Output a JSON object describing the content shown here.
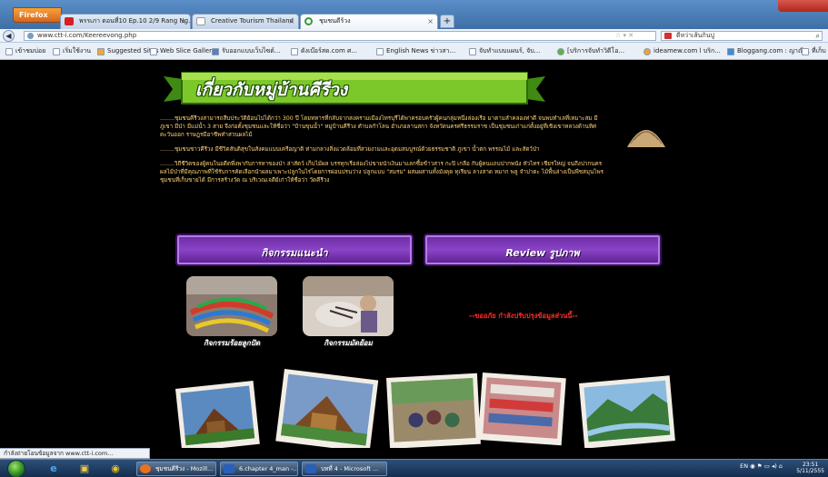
{
  "browser": {
    "app_button": "Firefox",
    "tabs": [
      {
        "label": "พรรเภา ตอนที่10 Ep.10 2/9 Rang Ng...",
        "favicon_color": "#d62020"
      },
      {
        "label": "Creative Tourism Thailand",
        "favicon_color": "#ffffff"
      },
      {
        "label": "ชุมชนดีร้วง",
        "favicon_color": "#3a9a3a"
      }
    ],
    "new_tab": "+",
    "url": "www.ctt-i.com/Keereevong.php",
    "search_text": "ดีหว่าเส้นกินปู",
    "bookmarks": [
      "เข้าชมบ่อย",
      "เริ่มใช้งาน",
      "Suggested Sites",
      "Web Slice Gallery",
      "รับออกแบบเว็บไซต์...",
      "ดังเบ๊อร์สด.com ศ...",
      "English News ข่าวสา...",
      "จับทำแบบแผนร์, จับ...",
      "[บริการจับทำวิดีโอ...",
      "ideamew.com l บริก...",
      "Bloggang.com : ญาณี...",
      "ที่เก็บ"
    ]
  },
  "page": {
    "title": "เกี่ยวกับหมู่บ้านคีรีวง",
    "paragraphs": [
      "........ชุมชนคีรีวงสามารถสืบประวัติย้อนไปได้กว่า 300 ปี โดยทหารที่กลับจากสงครามเมืองไทรบุรีได้พาครอบครัวผู้คนกลุ่มหนึ่งล่องเรือ มาตามลำคลองท่าดี จนพบทำเลที่เหมาะสม มีภูเขา มีป่า มีแม่น้ำ 3 สาย จึงก่อตั้งชุมชนและให้ชื่อว่า \"บ้านขุนน้ำ\" หมู่บ้านคีรีวง ตำบลกำโลน อำเภอลานสกา จังหวัดนครศรีธรรมราช เป็นชุมชนเก่าแก่ตั้งอยู่ที่เชิงเขาหลวงด้านทิศตะวันออก ราษฎรมีอาชีพทำสวนผลไม้",
      "........ชุมชนชาวคีรีวง มีชีวิตสันติสุขในสังคมแบบเครือญาติ ท่ามกลางสิ่งแวดล้อมที่สวยงามและอุดมสมบูรณ์ด้วยธรรมชาติ ภูเขา น้ำตก พรรณไม้ และสัตว์ป่า",
      "........วิถีชีวิตของผู้คนในอดีตพึ่งพากับการหาของป่า ล่าสัตว์ เก็บไม้ผล บรรทุกเรือล่องไปขายนำเงินมาแลกซื้อข้าวสาร กะปิ เกลือ กับผู้คนแถบปากพนัง หัวไทร เชียรใหญ่ จนถึงปากนคร ผลไม้ป่าที่มีคุณภาพที่ใช้รับการคัดเลือกนำผลมาเพาะปลูกในไร่โดยการผ่อนปรนว่าง ปลูกแบบ \"สมรม\" ผสมผสานทั้งมังคุด ทุเรียน ลางสาด หมาก พลู จำปาดะ ไม้พื้นล่างเป็นพืชสมุนไพร ชุมชนที่เก็บขายได้ มีการสร้างวัด ณ บริเวณเจดีย์เก่าให้ชื่อว่า วัดคีรีวง"
    ],
    "activities_header": "กิจกรรมแนะนำ",
    "review_header": "Review รูปภาพ",
    "activities": [
      {
        "caption": "กิจกรรมร้อยลูกปัด"
      },
      {
        "caption": "กิจกรรมมัดย้อม"
      }
    ],
    "review_note": "--ขออภัย กำลังปรับปรุงข้อมูลส่วนนี้--"
  },
  "status_text": "กำลังถ่ายโอนข้อมูลจาก www.ctt-i.com...",
  "taskbar": {
    "tasks": [
      {
        "label": "ชุมชนคีรีวง - Mozill...",
        "icon_color": "#e8731f"
      },
      {
        "label": "6.chapter 4_man -...",
        "icon_color": "#2b5fb8"
      },
      {
        "label": "บทที่ 4 - Microsoft ...",
        "icon_color": "#2b5fb8"
      }
    ],
    "tray_lang": "EN",
    "clock_time": "23:51",
    "clock_date": "5/11/2555"
  }
}
